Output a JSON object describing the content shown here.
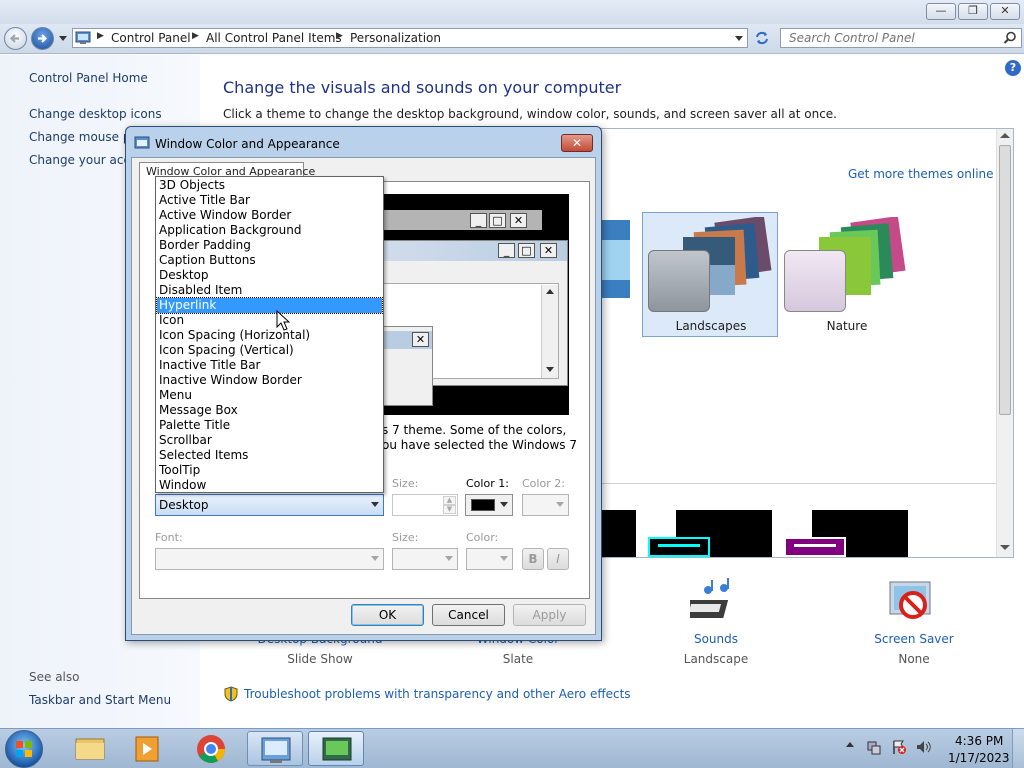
{
  "window": {
    "minimize_glyph": "—",
    "restore_glyph": "❐",
    "close_glyph": "✕"
  },
  "addressbar": {
    "breadcrumbs": [
      "Control Panel",
      "All Control Panel Items",
      "Personalization"
    ],
    "search_placeholder": "Search Control Panel"
  },
  "sidebar": {
    "home": "Control Panel Home",
    "links": [
      "Change desktop icons",
      "Change mouse po",
      "Change your acco"
    ],
    "see_also": "See also",
    "see_also_links": [
      "Taskbar and Start Menu"
    ]
  },
  "main": {
    "title": "Change the visuals and sounds on your computer",
    "subtitle": "Click a theme to change the desktop background, window color, sounds, and screen saver all at once.",
    "get_more": "Get more themes online",
    "themes": [
      {
        "label": "Landscapes",
        "selected": true
      },
      {
        "label": "Nature",
        "selected": false
      }
    ],
    "bottom_items": [
      {
        "label": "Desktop Background",
        "sub": "Slide Show"
      },
      {
        "label": "Window Color",
        "sub": "Slate"
      },
      {
        "label": "Sounds",
        "sub": "Landscape"
      },
      {
        "label": "Screen Saver",
        "sub": "None"
      }
    ],
    "troubleshoot": "Troubleshoot problems with transparency and other Aero effects"
  },
  "dialog": {
    "title": "Window Color and Appearance",
    "close_glyph": "✕",
    "tab": "Window Color and Appearance",
    "description": [
      "s 7 theme.  Some of the colors,",
      "ou have selected the Windows 7"
    ],
    "item_options": [
      "3D Objects",
      "Active Title Bar",
      "Active Window Border",
      "Application Background",
      "Border Padding",
      "Caption Buttons",
      "Desktop",
      "Disabled Item",
      "Hyperlink",
      "Icon",
      "Icon Spacing (Horizontal)",
      "Icon Spacing (Vertical)",
      "Inactive Title Bar",
      "Inactive Window Border",
      "Menu",
      "Message Box",
      "Palette Title",
      "Scrollbar",
      "Selected Items",
      "ToolTip",
      "Window"
    ],
    "highlighted_option": "Hyperlink",
    "item_value": "Desktop",
    "size_label": "Size:",
    "color1_label": "Color 1:",
    "color1_value": "#000000",
    "color2_label": "Color 2:",
    "font_label": "Font:",
    "font_size_label": "Size:",
    "font_color_label": "Color:",
    "bold_label": "B",
    "italic_label": "I",
    "ok": "OK",
    "cancel": "Cancel",
    "apply": "Apply"
  },
  "taskbar": {
    "time": "4:36 PM",
    "date": "1/17/2023"
  }
}
